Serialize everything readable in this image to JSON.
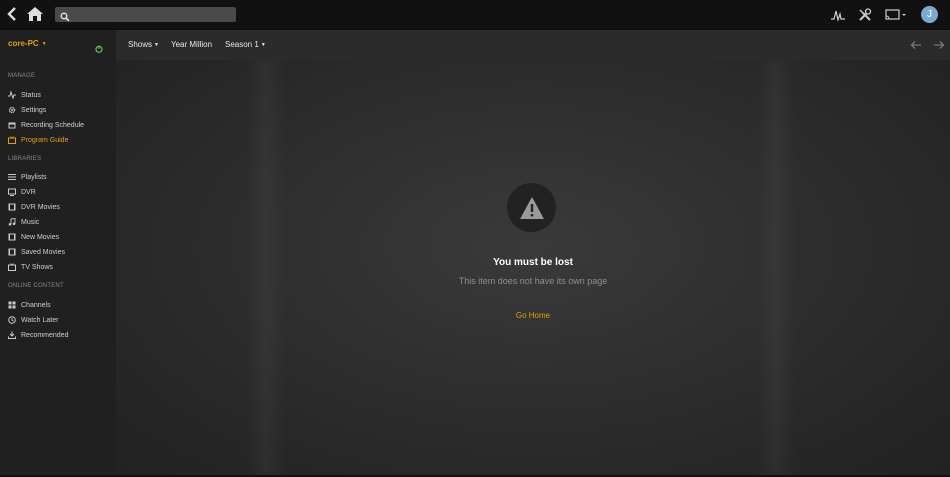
{
  "topbar": {
    "search_placeholder": "",
    "avatar_letter": "J"
  },
  "sidebar": {
    "server_name": "core-PC",
    "manage_header": "MANAGE",
    "manage_items": [
      {
        "label": "Status",
        "icon": "activity-icon"
      },
      {
        "label": "Settings",
        "icon": "gear-icon"
      },
      {
        "label": "Recording Schedule",
        "icon": "calendar-icon"
      },
      {
        "label": "Program Guide",
        "icon": "tv-guide-icon",
        "active": true
      }
    ],
    "libraries_header": "LIBRARIES",
    "library_items": [
      {
        "label": "Playlists",
        "icon": "playlist-icon"
      },
      {
        "label": "DVR",
        "icon": "dvr-icon"
      },
      {
        "label": "DVR Movies",
        "icon": "film-icon"
      },
      {
        "label": "Music",
        "icon": "music-icon"
      },
      {
        "label": "New Movies",
        "icon": "film-icon"
      },
      {
        "label": "Saved Movies",
        "icon": "film-icon"
      },
      {
        "label": "TV Shows",
        "icon": "tv-icon"
      }
    ],
    "online_header": "ONLINE CONTENT",
    "online_items": [
      {
        "label": "Channels",
        "icon": "grid-icon"
      },
      {
        "label": "Watch Later",
        "icon": "clock-icon"
      },
      {
        "label": "Recommended",
        "icon": "download-icon"
      }
    ]
  },
  "breadcrumb": {
    "shows": "Shows",
    "title": "Year Million",
    "season": "Season 1"
  },
  "error": {
    "title": "You must be lost",
    "subtitle": "This item does not have its own page",
    "link": "Go Home"
  },
  "colors": {
    "accent": "#e5a00d",
    "server_online": "#6cc24a"
  }
}
